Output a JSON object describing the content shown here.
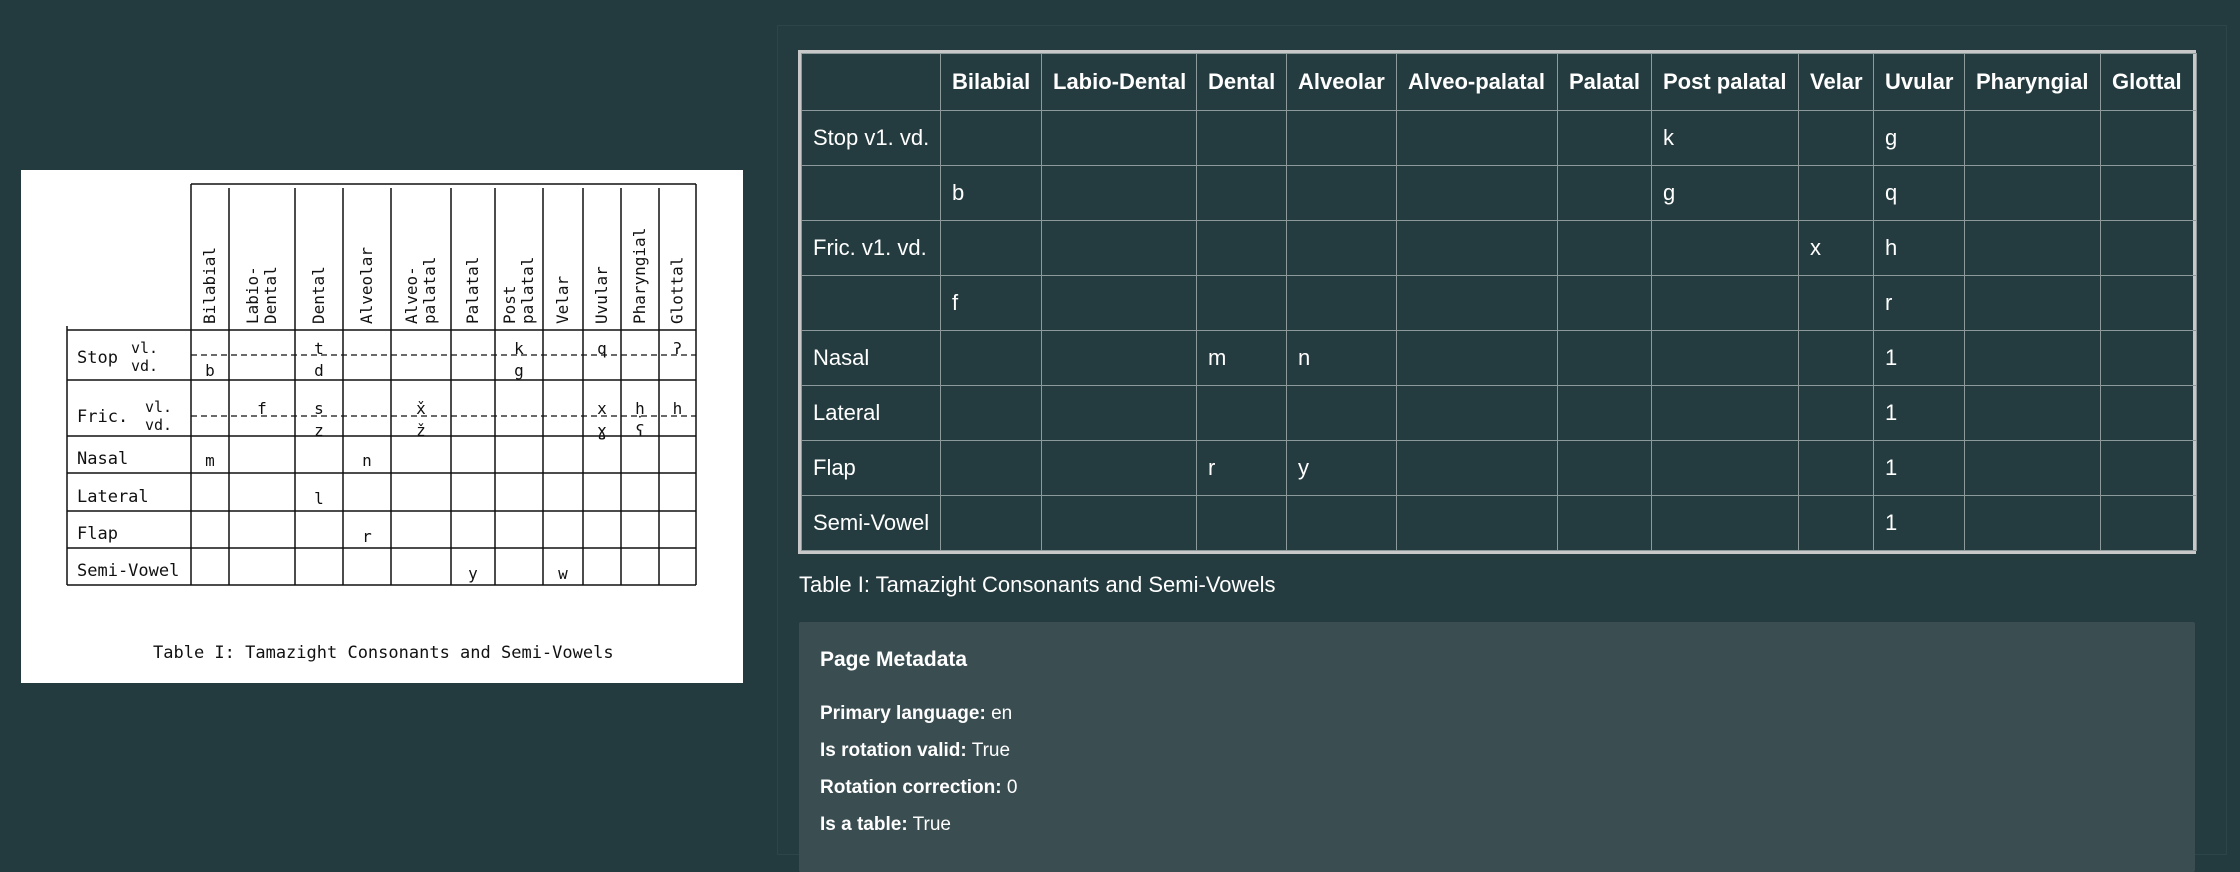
{
  "scan": {
    "column_headers": [
      "Bilabial",
      "Labio-\nDental",
      "Dental",
      "Alveolar",
      "Alveo-\npalatal",
      "Palatal",
      "Post\npalatal",
      "Velar",
      "Uvular",
      "Pharyngial",
      "Glottal"
    ],
    "row_headers": [
      "Stop",
      "vl.",
      "vd.",
      "Fric.",
      "vl.",
      "vd.",
      "Nasal",
      "Lateral",
      "Flap",
      "Semi-Vowel"
    ],
    "cells": {
      "stop_vl": [
        "",
        "",
        "t",
        "",
        "",
        "",
        "k",
        "",
        "q",
        "",
        "ʔ"
      ],
      "stop_vd": [
        "b",
        "",
        "d",
        "",
        "",
        "",
        "g",
        "",
        "",
        "",
        ""
      ],
      "fric_vl": [
        "",
        "f",
        "s",
        "",
        "x̌",
        "",
        "",
        "",
        "x",
        "ḥ",
        "h"
      ],
      "fric_vd": [
        "",
        "",
        "z",
        "",
        "ž",
        "",
        "",
        "",
        "ɣ",
        "ʕ",
        ""
      ],
      "nasal": [
        "m",
        "",
        "",
        "n",
        "",
        "",
        "",
        "",
        "",
        "",
        ""
      ],
      "lateral": [
        "",
        "",
        "l",
        "",
        "",
        "",
        "",
        "",
        "",
        "",
        ""
      ],
      "flap": [
        "",
        "",
        "",
        "r",
        "",
        "",
        "",
        "",
        "",
        "",
        ""
      ],
      "semivowel": [
        "",
        "",
        "",
        "",
        "",
        "y",
        "",
        "w",
        "",
        "",
        ""
      ]
    },
    "caption": "Table I:  Tamazight Consonants and Semi-Vowels"
  },
  "table": {
    "headers": [
      "",
      "Bilabial",
      "Labio-Dental",
      "Dental",
      "Alveolar",
      "Alveo-palatal",
      "Palatal",
      "Post palatal",
      "Velar",
      "Uvular",
      "Pharyngial",
      "Glottal"
    ],
    "rows": [
      [
        "Stop v1. vd.",
        "",
        "",
        "",
        "",
        "",
        "",
        "k",
        "",
        "g",
        "",
        ""
      ],
      [
        "",
        "b",
        "",
        "",
        "",
        "",
        "",
        "g",
        "",
        "q",
        "",
        ""
      ],
      [
        "Fric. v1. vd.",
        "",
        "",
        "",
        "",
        "",
        "",
        "",
        "x",
        "h",
        "",
        ""
      ],
      [
        "",
        "f",
        "",
        "",
        "",
        "",
        "",
        "",
        "",
        "r",
        "",
        ""
      ],
      [
        "Nasal",
        "",
        "",
        "m",
        "n",
        "",
        "",
        "",
        "",
        "1",
        "",
        ""
      ],
      [
        "Lateral",
        "",
        "",
        "",
        "",
        "",
        "",
        "",
        "",
        "1",
        "",
        ""
      ],
      [
        "Flap",
        "",
        "",
        "r",
        "y",
        "",
        "",
        "",
        "",
        "1",
        "",
        ""
      ],
      [
        "Semi-Vowel",
        "",
        "",
        "",
        "",
        "",
        "",
        "",
        "",
        "1",
        "",
        ""
      ]
    ]
  },
  "caption": "Table I: Tamazight Consonants and Semi-Vowels",
  "metadata": {
    "title": "Page Metadata",
    "primary_language_label": "Primary language:",
    "primary_language": "en",
    "rotation_valid_label": "Is rotation valid:",
    "rotation_valid": "True",
    "rotation_correction_label": "Rotation correction:",
    "rotation_correction": "0",
    "is_table_label": "Is a table:",
    "is_table": "True"
  }
}
